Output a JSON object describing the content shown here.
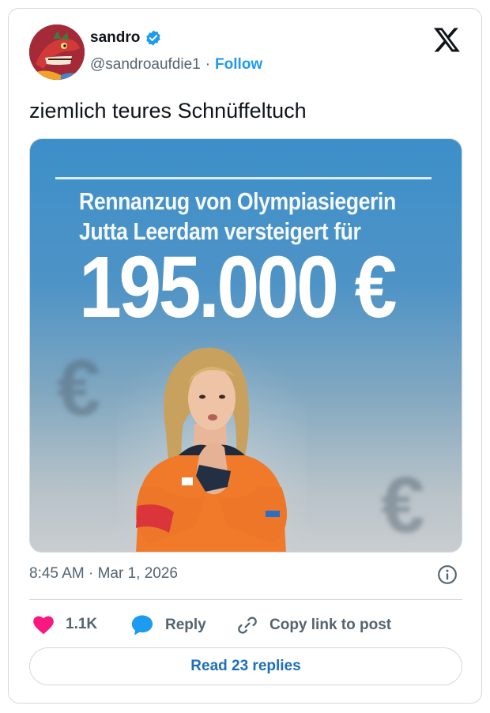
{
  "author": {
    "name": "sandro",
    "handle": "@sandroaufdie1",
    "separator": "·",
    "follow_label": "Follow",
    "verified": true
  },
  "tweet": {
    "text": "ziemlich teures Schnüffeltuch"
  },
  "media": {
    "headline_line1": "Rennanzug von Olympiasiegerin",
    "headline_line2": "Jutta Leerdam versteigert für",
    "price": "195.000 €",
    "background_symbol": "€"
  },
  "meta": {
    "timestamp": "8:45 AM · Mar 1, 2026"
  },
  "actions": {
    "like_count": "1.1K",
    "reply_label": "Reply",
    "copy_label": "Copy link to post"
  },
  "read_replies_label": "Read 23 replies",
  "colors": {
    "accent": "#1d9bf0",
    "like": "#f91880",
    "text_secondary": "#536471",
    "border": "#cfd9de"
  },
  "icons": {
    "logo": "x-logo-icon",
    "verified": "verified-badge-icon",
    "info": "info-icon",
    "like": "heart-icon",
    "reply": "speech-bubble-icon",
    "copy": "link-icon"
  }
}
